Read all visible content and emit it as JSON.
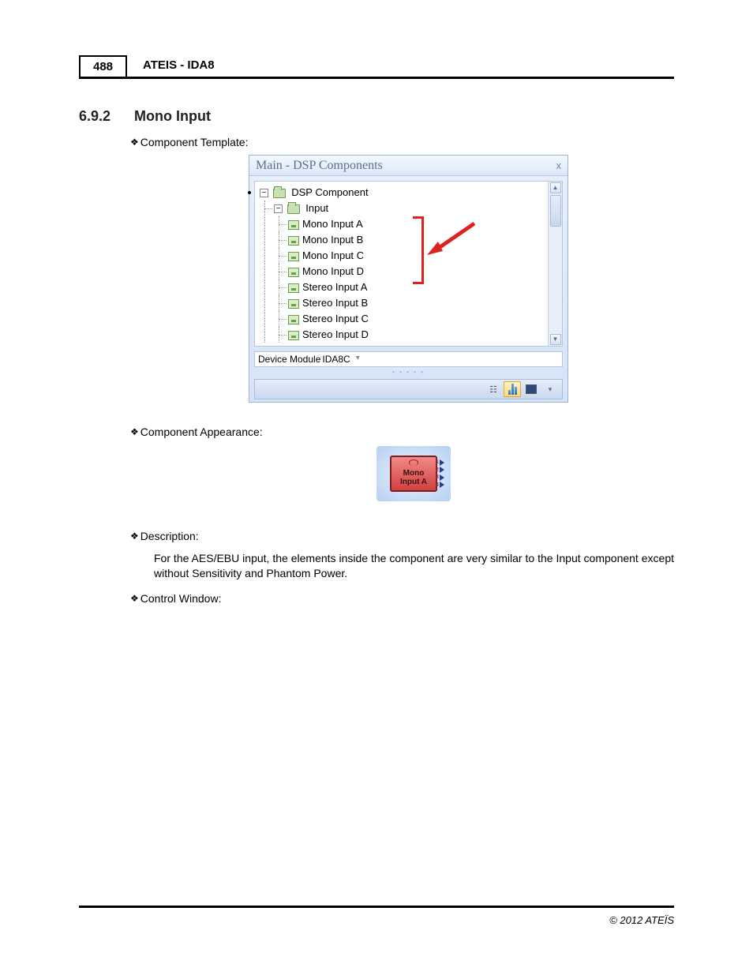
{
  "header": {
    "page_number": "488",
    "doc_title": "ATEIS - IDA8"
  },
  "section": {
    "number": "6.9.2",
    "title": "Mono Input"
  },
  "bullets": {
    "template": "Component Template:",
    "appearance": "Component Appearance:",
    "description_label": "Description:",
    "description_body": "For the AES/EBU input, the elements inside the component are very similar to the Input component except without Sensitivity and Phantom Power.",
    "control_window": "Control Window:"
  },
  "panel": {
    "title": "Main - DSP Components",
    "tree": {
      "root": "DSP Component",
      "branch": "Input",
      "items": [
        "Mono Input A",
        "Mono Input B",
        "Mono Input C",
        "Mono Input D",
        "Stereo Input A",
        "Stereo Input B",
        "Stereo Input C",
        "Stereo Input D"
      ]
    },
    "device_label": "Device Module",
    "device_value": "IDA8C"
  },
  "appearance_block": {
    "line1": "Mono",
    "line2": "Input A",
    "pins": [
      "1",
      "2",
      "3",
      "4"
    ]
  },
  "footer": {
    "copyright": "© 2012 ATEÏS"
  }
}
